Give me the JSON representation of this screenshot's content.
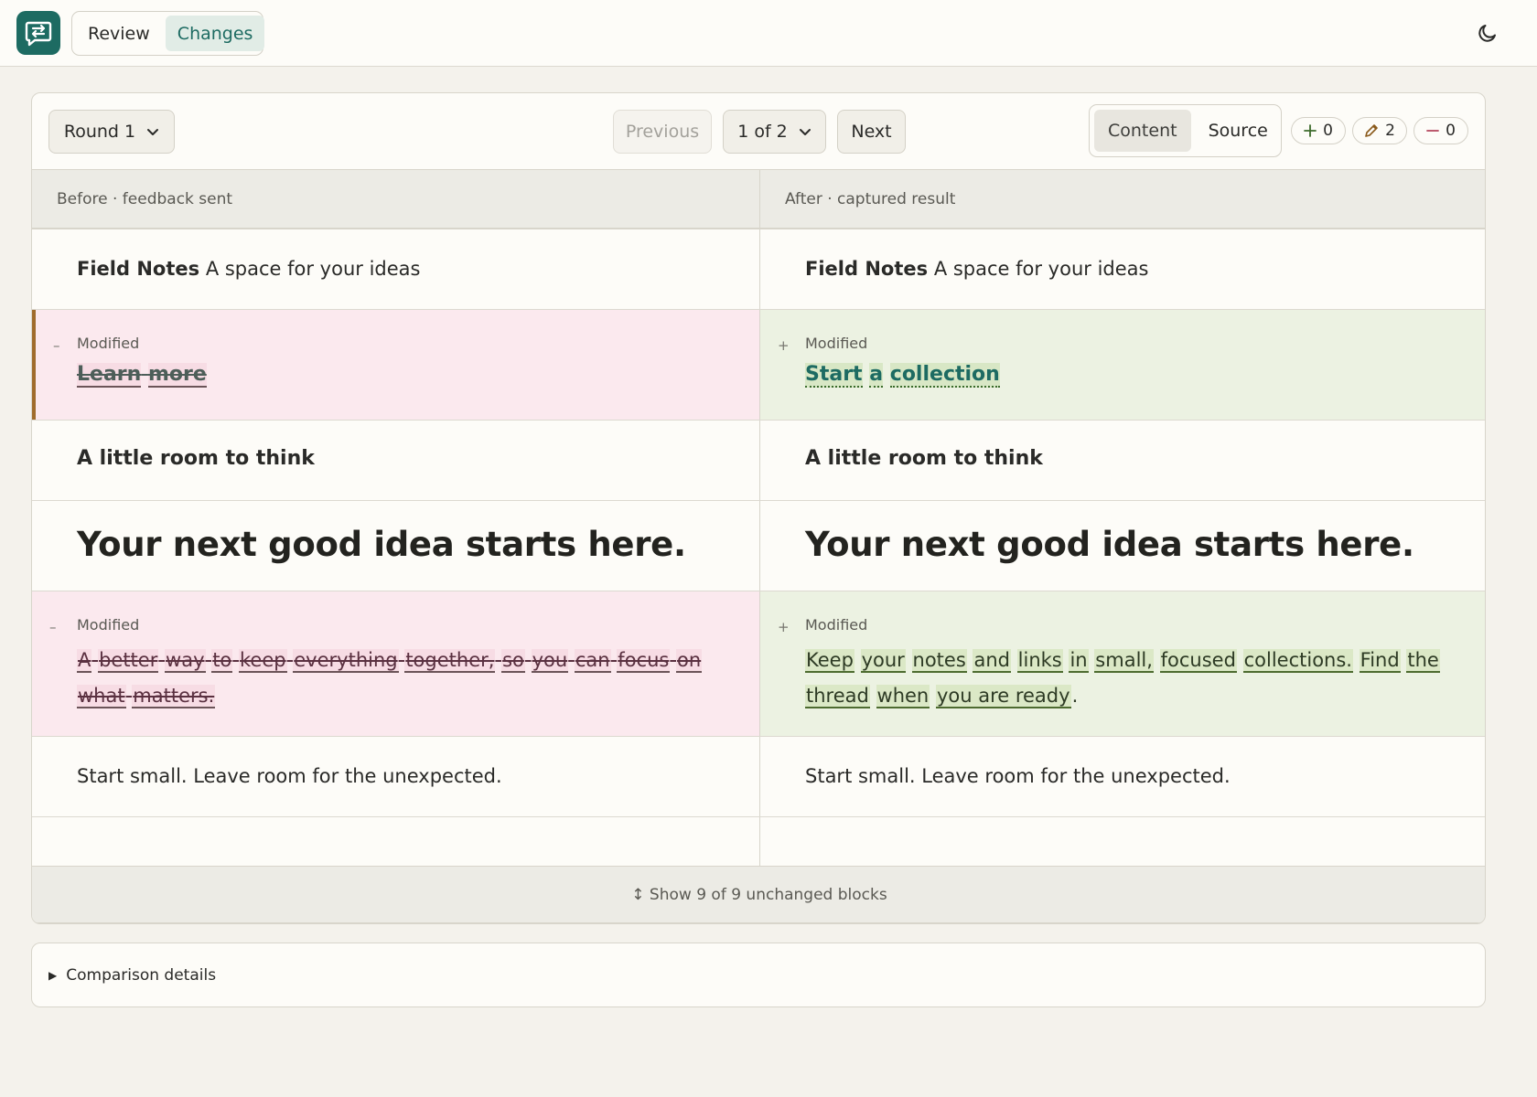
{
  "header": {
    "logo_icon": "swap-chat-icon",
    "tabs": [
      {
        "label": "Review",
        "active": false
      },
      {
        "label": "Changes",
        "active": true
      }
    ],
    "theme_icon": "moon-icon"
  },
  "toolbar": {
    "round_label": "Round 1",
    "previous_label": "Previous",
    "page_label": "1 of 2",
    "next_label": "Next",
    "view_tabs": [
      {
        "label": "Content",
        "active": true
      },
      {
        "label": "Source",
        "active": false
      }
    ],
    "counts": {
      "added": "0",
      "modified": "2",
      "removed": "0"
    }
  },
  "diff": {
    "before_header": "Before · feedback sent",
    "after_header": "After · captured result",
    "brand_title": "Field Notes",
    "brand_tagline": "A space for your ideas",
    "modified_label": "Modified",
    "row2_before_words": [
      "Learn",
      "more"
    ],
    "row2_after_words": [
      "Start",
      "a",
      "collection"
    ],
    "row3_heading": "A little room to think",
    "row4_heading": "Your next good idea starts here.",
    "row5_before_words": [
      "A",
      "better",
      "way",
      "to",
      "keep",
      "everything",
      "together,",
      "so",
      "you",
      "can",
      "focus",
      "on",
      "what",
      "matters."
    ],
    "row5_after_words": [
      "Keep",
      "your",
      "notes",
      "and",
      "links",
      "in",
      "small,",
      "focused",
      "collections.",
      "Find",
      "the",
      "thread",
      "when",
      "you are ready",
      "."
    ],
    "row6_text": "Start small. Leave room for the unexpected.",
    "show_more": "↕ Show 9 of 9 unchanged blocks"
  },
  "details": {
    "summary": "Comparison details"
  },
  "colors": {
    "accent": "#1d6b62",
    "removed_bg": "#fbe9ee",
    "added_bg": "#ecf2e2",
    "modified_marker": "#a06c2c"
  }
}
